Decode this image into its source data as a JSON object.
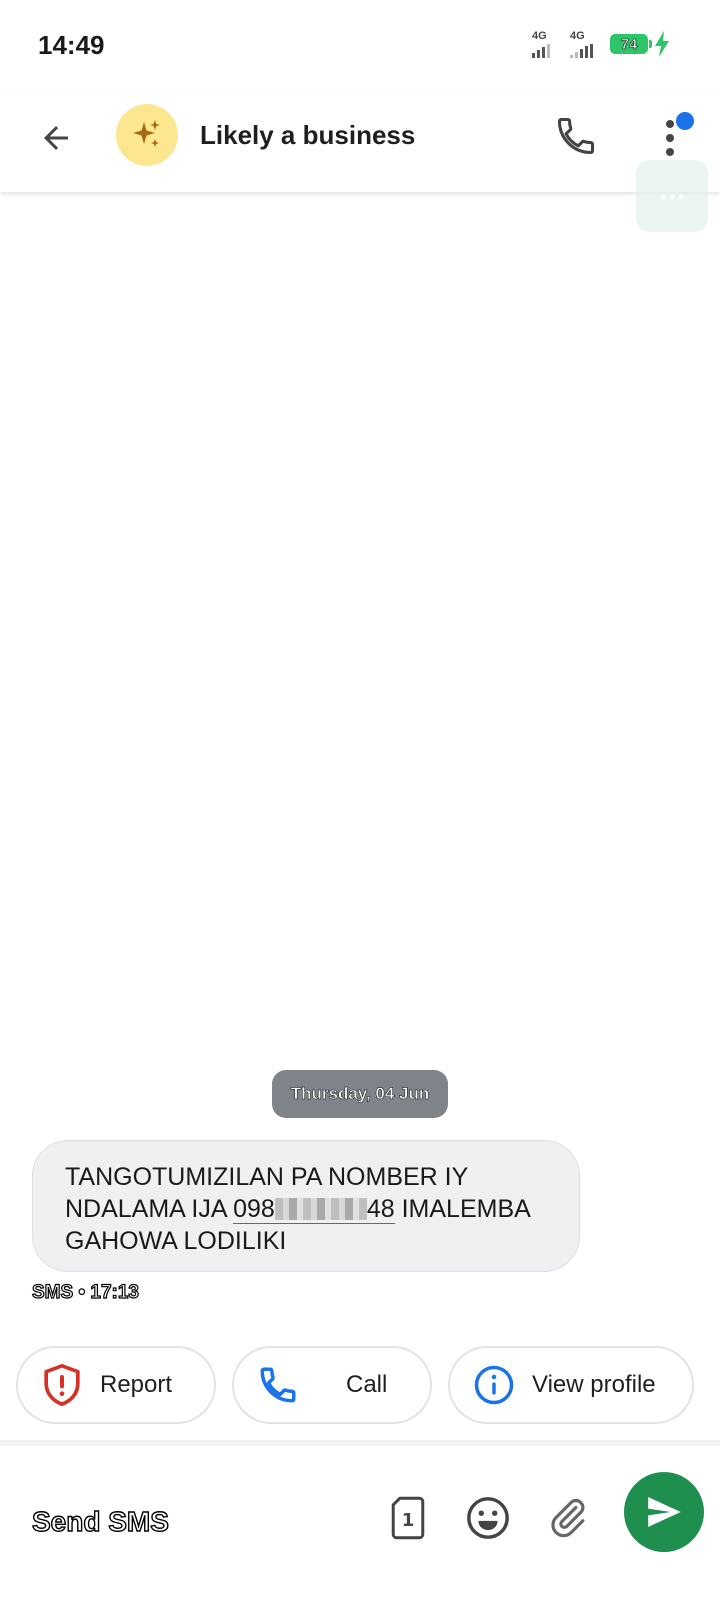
{
  "status_bar": {
    "time": "14:49",
    "sim1_label": "4G",
    "sim2_label": "4G",
    "battery": "74"
  },
  "header": {
    "title": "Likely a business",
    "avatar_icon": "sparkle-icon",
    "notification_color": "#1a73e8"
  },
  "conversation": {
    "date_chip": "Thursday, 04 Jun",
    "message": {
      "text_before": "TANGOTUMIZILAN PA NOMBER IY NDALAMA IJA ",
      "number_start": "098",
      "number_end": "48",
      "text_after": " IMALEMBA GAHOWA LODILIKI",
      "meta": "SMS • 17:13"
    }
  },
  "actions": {
    "report": "Report",
    "call": "Call",
    "view_profile": "View profile"
  },
  "composer": {
    "placeholder": "Send SMS",
    "sim_number": "1",
    "send_color": "#1e8f4e"
  }
}
